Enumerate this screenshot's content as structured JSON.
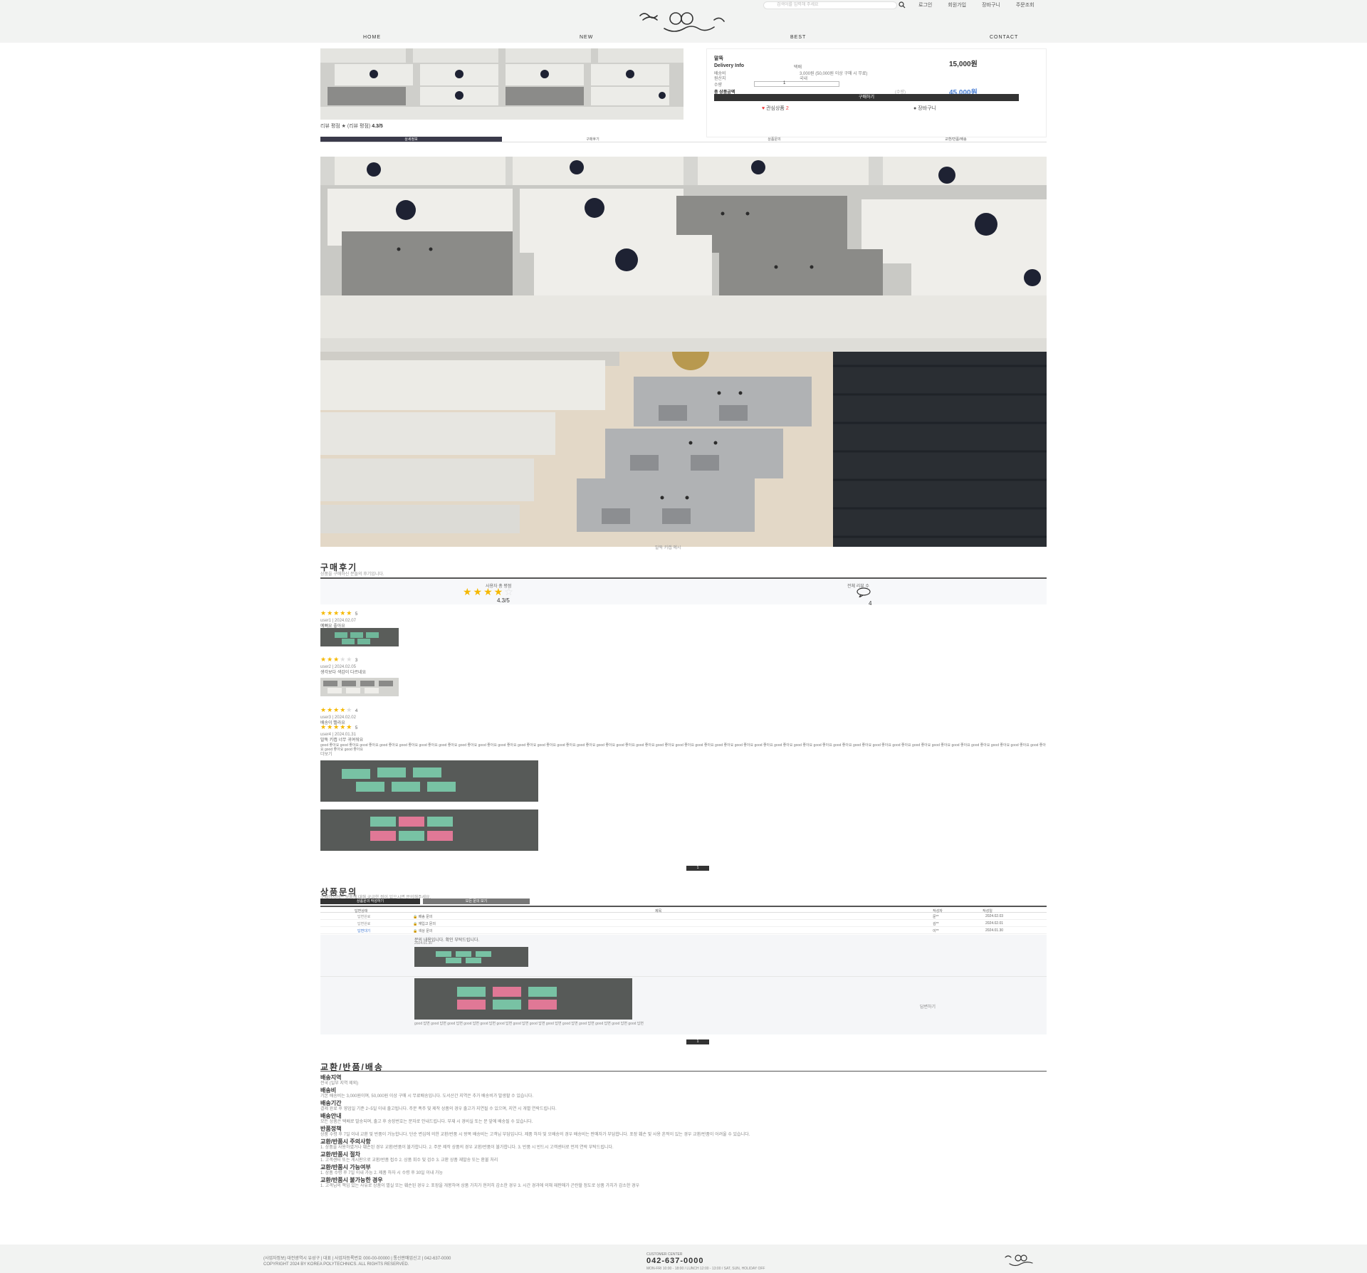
{
  "header": {
    "search_placeholder": "검색어를 입력해 주세요",
    "top_links": [
      "로그인",
      "회원가입",
      "장바구니",
      "주문조회"
    ],
    "gnb": [
      "HOME",
      "NEW",
      "BEST",
      "CONTACT"
    ]
  },
  "product": {
    "rating_line_prefix": "리뷰 평점 ★ (리뷰 평점)",
    "rating_value": "4.3/5",
    "name": "말뚝",
    "price": "15,000원",
    "delivery_label": "Delivery Info",
    "delivery_method": "택배",
    "ship_label": "배송비",
    "ship_value": "3,000원 (50,000원 이상 구매 시 무료)",
    "origin_label": "원산지",
    "origin_value": "국내",
    "qty_label": "수량",
    "qty_value": "1",
    "total_label": "총 상품금액",
    "total_small": "(수량)",
    "total_amount": "45,000원",
    "buy_label": "구매하기",
    "wish_label": "관심상품",
    "wish_count": "2",
    "cart_label": "장바구니"
  },
  "tabs": [
    "상세정보",
    "구매후기",
    "상품문의",
    "교환/반품/배송"
  ],
  "detail_caption": "말뚝 키캡 예시",
  "reviews": {
    "title": "구매후기",
    "subtitle": "상품을 구매하신 분들의 후기입니다.",
    "avg_label": "사용자 총 평점",
    "avg_score": "4.3/5",
    "count_label": "전체 리뷰 수",
    "count_value": "4",
    "items": [
      {
        "stars": "★★★★★",
        "off": "",
        "score": "5",
        "meta": "user1 | 2024.02.07",
        "body": "예뻐요 좋아요"
      },
      {
        "stars": "★★★",
        "off": "★★",
        "score": "3",
        "meta": "user2 | 2024.02.05",
        "body": "생각보다 색감이 다르네요"
      },
      {
        "stars": "★★★★",
        "off": "★",
        "score": "4",
        "meta": "user3 | 2024.02.02",
        "body": "배송이 빨라요"
      },
      {
        "stars": "★★★★★",
        "off": "",
        "score": "5",
        "meta": "user4 | 2024.01.31",
        "body": "말뚝 키캡 너무 귀여워요"
      }
    ],
    "long_text": "good 좋아요 good 좋아요 good 좋아요 good 좋아요 good 좋아요 good 좋아요 good 좋아요 good 좋아요 good 좋아요 good 좋아요 good 좋아요 good 좋아요 good 좋아요 good 좋아요 good 좋아요 good 좋아요 good 좋아요 good 좋아요 good 좋아요 good 좋아요 good 좋아요 good 좋아요 good 좋아요 good 좋아요 good 좋아요 good 좋아요 good 좋아요 good 좋아요 good 좋아요 good 좋아요 good 좋아요 good 좋아요 good 좋아요 good 좋아요 good 좋아요 good 좋아요 good 좋아요 good 좋아요 good 좋아요",
    "more": "더보기",
    "pager": "1"
  },
  "qna": {
    "title": "상품문의",
    "subtitle": "구매하시려는 상품에 대해 궁금한 점이 있으시면 문의해주세요.",
    "btn_write": "상품문의 작성하기",
    "btn_all": "모든 문의 보기",
    "cols": [
      "답변상태",
      "제목",
      "작성자",
      "작성일"
    ],
    "rows": [
      {
        "status": "답변완료",
        "title": "🔒 배송 문의",
        "writer": "문**",
        "date": "2024.02.03"
      },
      {
        "status": "답변완료",
        "title": "🔒 재입고 문의",
        "writer": "김**",
        "date": "2024.02.01"
      },
      {
        "status": "답변대기",
        "title": "🔒 색상 문의",
        "writer": "이**",
        "date": "2024.01.30"
      }
    ],
    "detail_text": "문의 내용입니다. 확인 부탁드립니다.",
    "detail_sub": "2024.01.30",
    "answer_text": "good 답변 good 답변 good 답변 good 답변 good 답변 good 답변 good 답변 good 답변 good 답변 good 답변 good 답변 good 답변 good 답변 good 답변",
    "reply_label": "답변하기",
    "pager": "1"
  },
  "shipping": {
    "title": "교환/반품/배송",
    "sections": [
      {
        "h": "배송지역",
        "t": "전국 (일부 지역 제외)"
      },
      {
        "h": "배송비",
        "t": "기본 배송비는 3,000원이며, 50,000원 이상 구매 시 무료배송입니다. 도서산간 지역은 추가 배송비가 발생할 수 있습니다."
      },
      {
        "h": "배송기간",
        "t": "결제 완료 후 영업일 기준 2~5일 이내 출고됩니다. 주문 폭주 및 제작 상품의 경우 출고가 지연될 수 있으며, 지연 시 개별 연락드립니다."
      },
      {
        "h": "배송안내",
        "t": "모든 상품은 택배로 발송되며, 출고 후 송장번호는 문자로 안내드립니다. 부재 시 경비실 또는 문 앞에 배송될 수 있습니다."
      },
      {
        "h": "반품정책",
        "t": "상품 수령 후 7일 이내 교환 및 반품이 가능합니다. 단순 변심에 의한 교환/반품 시 왕복 배송비는 고객님 부담입니다. 제품 하자 및 오배송의 경우 배송비는 판매자가 부담합니다. 포장 훼손 및 사용 흔적이 있는 경우 교환/반품이 어려울 수 있습니다."
      },
      {
        "h": "교환/반품시 주의사항",
        "t": "1. 상품을 사용하였거나 훼손된 경우 교환/반품이 불가합니다. 2. 주문 제작 상품의 경우 교환/반품이 불가합니다. 3. 반품 시 반드시 고객센터로 먼저 연락 부탁드립니다."
      },
      {
        "h": "교환/반품시 절차",
        "t": "1. 고객센터 또는 게시판으로 교환/반품 접수 2. 상품 회수 및 검수 3. 교환 상품 재발송 또는 환불 처리"
      },
      {
        "h": "교환/반품시 가능여부",
        "t": "1. 상품 수령 후 7일 이내 가능 2. 제품 하자 시 수령 후 30일 이내 가능"
      },
      {
        "h": "교환/반품시 불가능한 경우",
        "t": "1. 고객님의 책임 있는 사유로 상품이 멸실 또는 훼손된 경우 2. 포장을 개봉하여 상품 가치가 현저히 감소한 경우 3. 시간 경과에 의해 재판매가 곤란할 정도로 상품 가치가 감소한 경우"
      }
    ]
  },
  "footer": {
    "line1": "(사업자정보) 대전광역시 유성구 | 대표 | 사업자등록번호 000-00-00000 | 통신판매업신고 | 042-637-0000",
    "line2": "COPYRIGHT 2024 BY KOREA POLYTECHNICS. ALL RIGHTS RESERVED.",
    "cc_label": "CUSTOMER CENTER",
    "cc_number": "042-637-0000",
    "cc_hours": "MON-FRI 10:00 - 18:00 / LUNCH 12:00 - 13:00 / SAT, SUN, HOLIDAY OFF"
  }
}
